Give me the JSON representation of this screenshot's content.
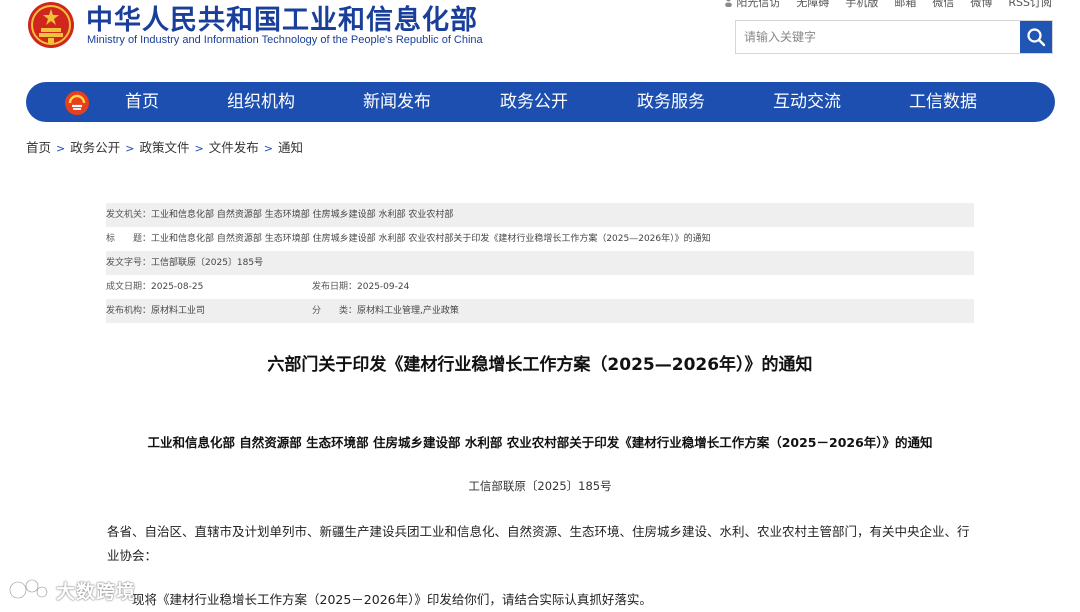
{
  "header": {
    "cn_title": "中华人民共和国工业和信息化部",
    "en_title": "Ministry of Industry and Information Technology of the People's Republic of China",
    "top_links": [
      "阳光信访",
      "无障碍",
      "手机版",
      "邮箱",
      "微信",
      "微博",
      "RSS订阅"
    ],
    "search": {
      "placeholder": "请输入关键字",
      "icon": "search-icon"
    },
    "brand_color": "#1d4fb0"
  },
  "nav": {
    "items": [
      "首页",
      "组织机构",
      "新闻发布",
      "政务公开",
      "政务服务",
      "互动交流",
      "工信数据"
    ]
  },
  "breadcrumb": [
    "首页",
    "政务公开",
    "政策文件",
    "文件发布",
    "通知"
  ],
  "meta": {
    "issuer_label": "发文机关：",
    "issuer": "工业和信息化部 自然资源部 生态环境部 住房城乡建设部 水利部 农业农村部",
    "title_label": "标　　题：",
    "title": "工业和信息化部 自然资源部 生态环境部 住房城乡建设部 水利部 农业农村部关于印发《建材行业稳增长工作方案（2025—2026年）》的通知",
    "docno_label": "发文字号：",
    "docno": "工信部联原〔2025〕185号",
    "written_label": "成文日期：",
    "written": "2025-08-25",
    "published_label": "发布日期：",
    "published": "2025-09-24",
    "agency_label": "发布机构：",
    "agency": "原材料工业司",
    "category_label": "分　　类：",
    "category": "原材料工业管理,产业政策"
  },
  "article": {
    "title": "六部门关于印发《建材行业稳增长工作方案（2025—2026年）》的通知",
    "subtitle": "工业和信息化部  自然资源部  生态环境部  住房城乡建设部  水利部  农业农村部关于印发《建材行业稳增长工作方案（2025－2026年）》的通知",
    "doc_number": "工信部联原〔2025〕185号",
    "recipients": "各省、自治区、直辖市及计划单列市、新疆生产建设兵团工业和信息化、自然资源、生态环境、住房城乡建设、水利、农业农村主管部门，有关中央企业、行业协会：",
    "body": "现将《建材行业稳增长工作方案（2025－2026年）》印发给你们，请结合实际认真抓好落实。"
  },
  "watermark": {
    "text": "大数跨境"
  }
}
